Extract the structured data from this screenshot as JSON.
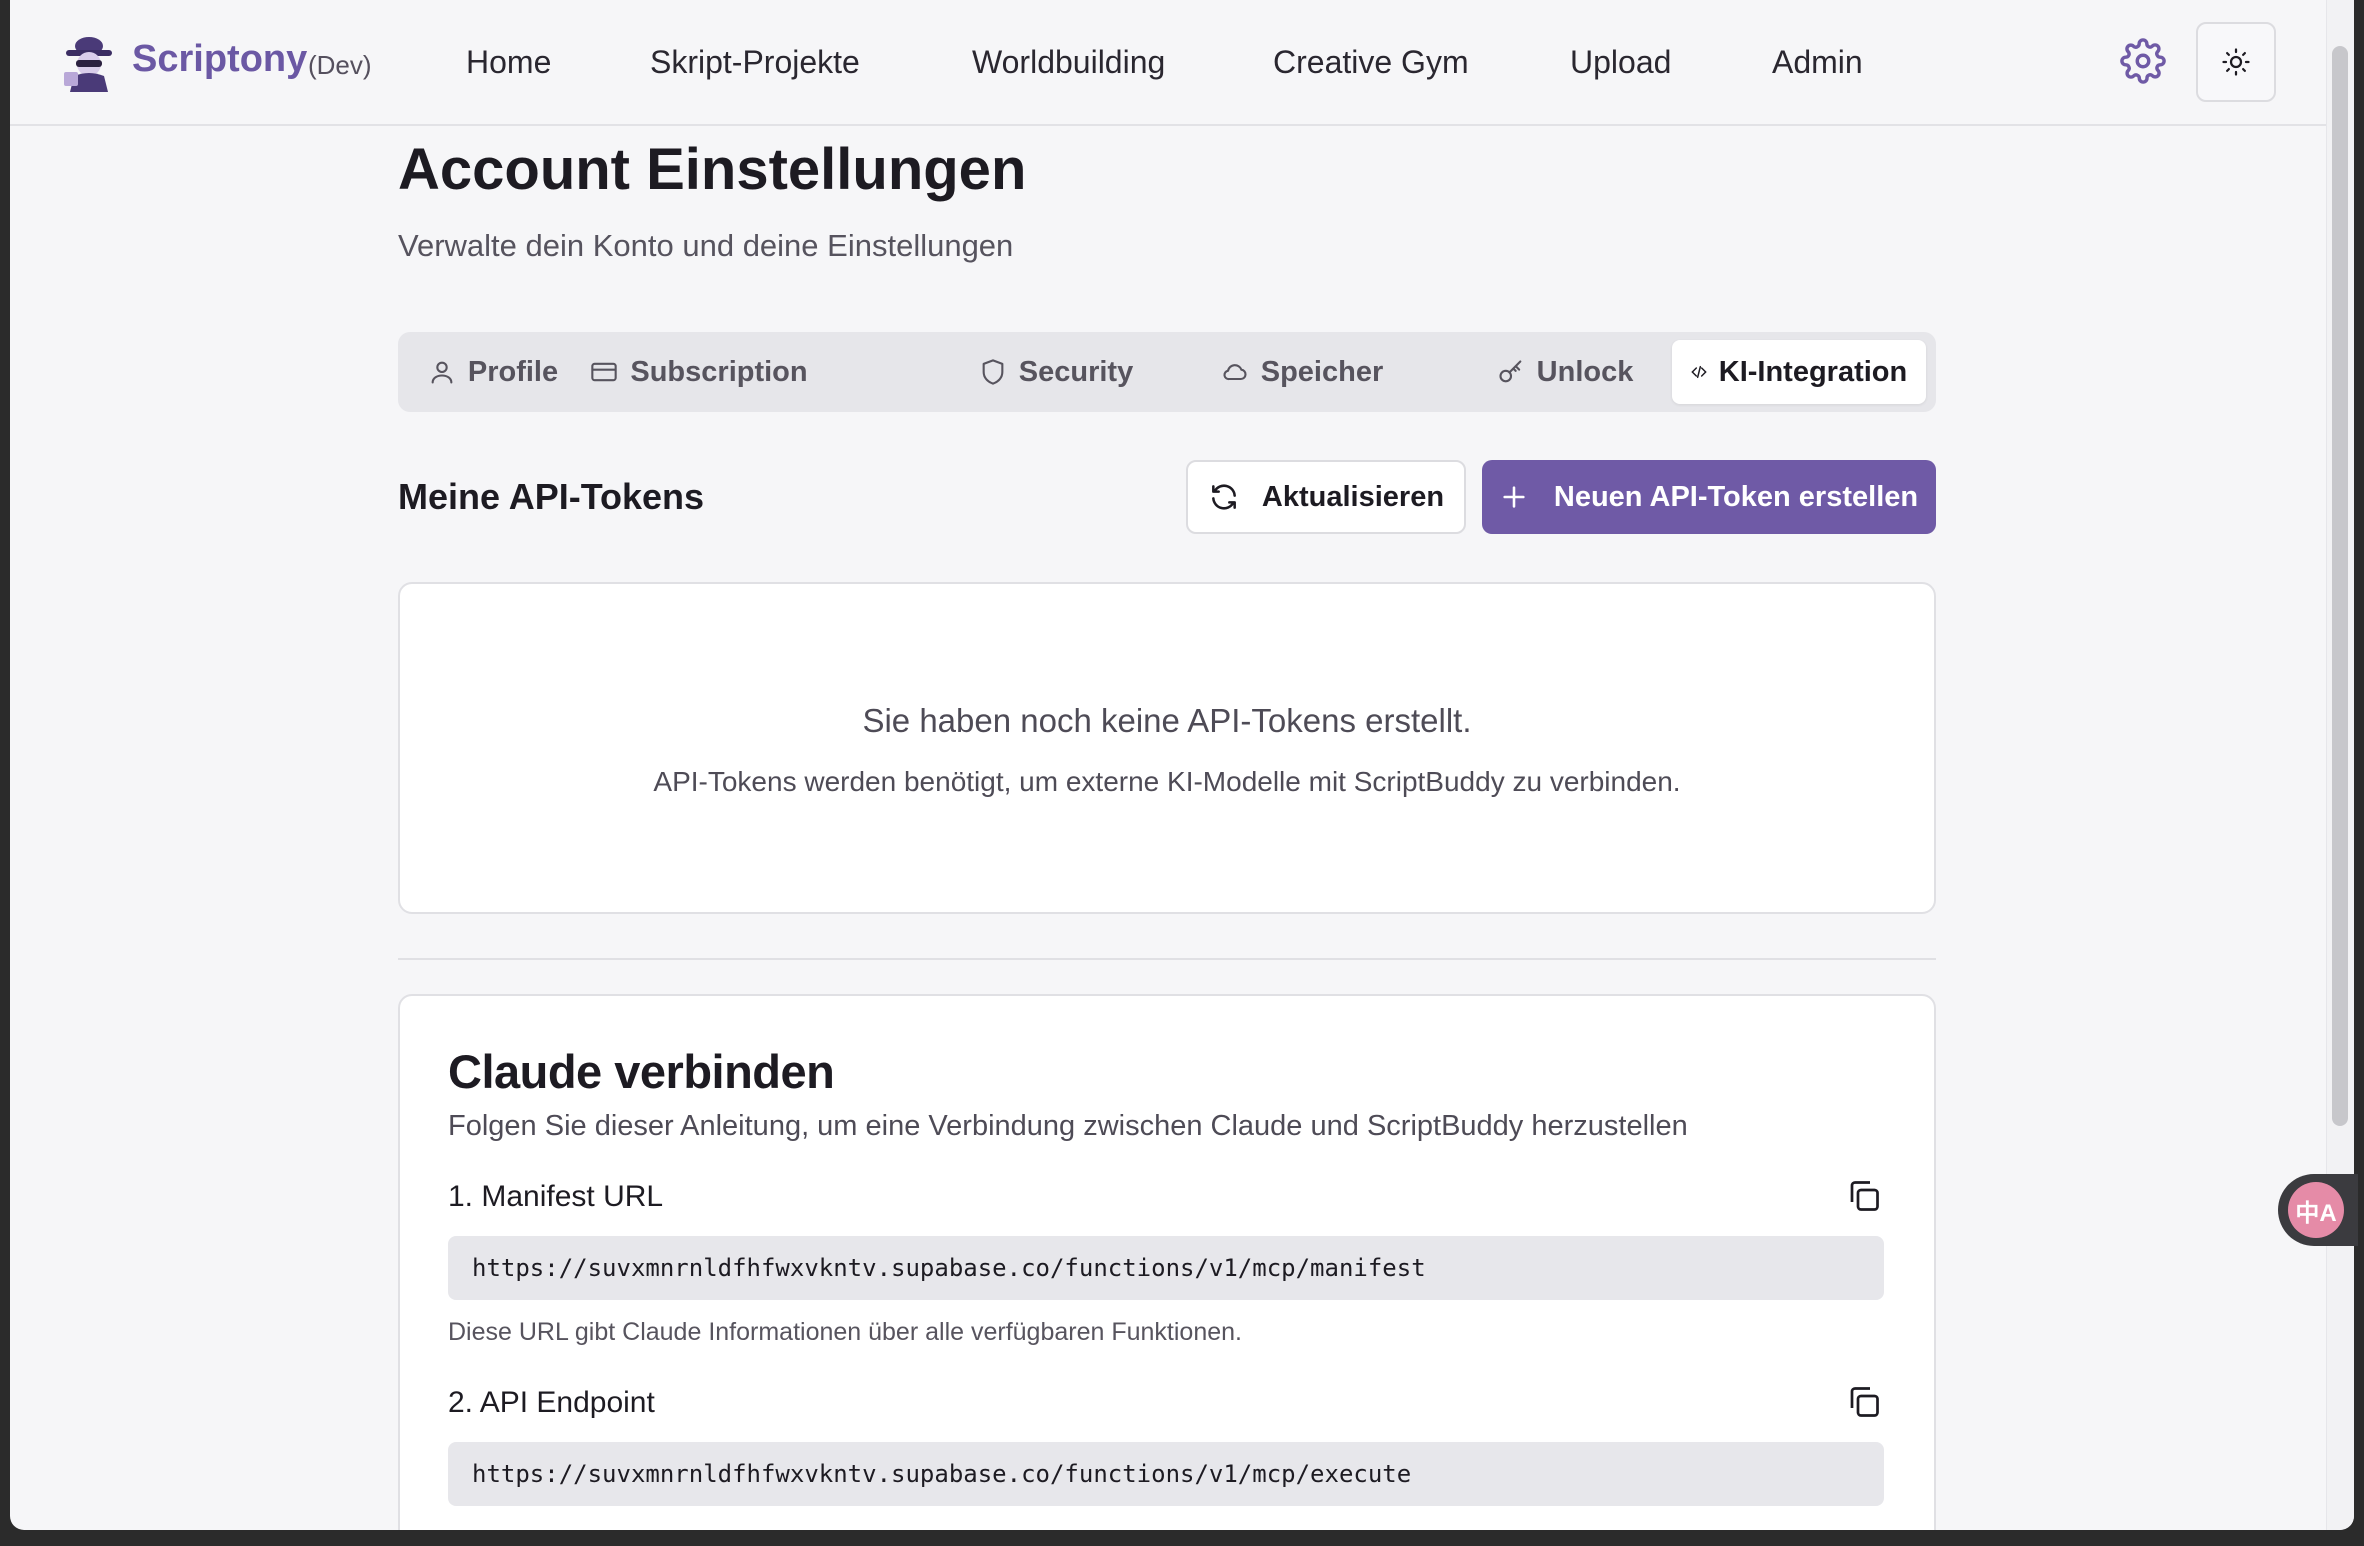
{
  "header": {
    "brand": "Scriptony",
    "env": "(Dev)",
    "nav": [
      "Home",
      "Skript-Projekte",
      "Worldbuilding",
      "Creative Gym",
      "Upload",
      "Admin"
    ]
  },
  "page": {
    "title": "Account Einstellungen",
    "subtitle": "Verwalte dein Konto und deine Einstellungen"
  },
  "tabs": [
    {
      "label": "Profile",
      "icon": "user-icon"
    },
    {
      "label": "Subscription",
      "icon": "credit-card-icon"
    },
    {
      "label": "Security",
      "icon": "shield-icon"
    },
    {
      "label": "Speicher",
      "icon": "cloud-icon"
    },
    {
      "label": "Unlock",
      "icon": "key-icon"
    },
    {
      "label": "KI-Integration",
      "icon": "code-icon",
      "active": true
    }
  ],
  "tokens": {
    "title": "Meine API-Tokens",
    "refresh_label": "Aktualisieren",
    "create_label": "Neuen API-Token erstellen",
    "empty_title": "Sie haben noch keine API-Tokens erstellt.",
    "empty_desc": "API-Tokens werden benötigt, um externe KI-Modelle mit ScriptBuddy zu verbinden."
  },
  "claude": {
    "title": "Claude verbinden",
    "desc": "Folgen Sie dieser Anleitung, um eine Verbindung zwischen Claude und ScriptBuddy herzustellen",
    "steps": [
      {
        "label": "1. Manifest URL",
        "url": "https://suvxmnrnldfhfwxvkntv.supabase.co/functions/v1/mcp/manifest",
        "hint": "Diese URL gibt Claude Informationen über alle verfügbaren Funktionen."
      },
      {
        "label": "2. API Endpoint",
        "url": "https://suvxmnrnldfhfwxvkntv.supabase.co/functions/v1/mcp/execute"
      }
    ]
  },
  "translate_widget": "中A",
  "colors": {
    "accent": "#6f5aa6",
    "brand": "#6b58a4",
    "background": "#f6f6f8"
  }
}
